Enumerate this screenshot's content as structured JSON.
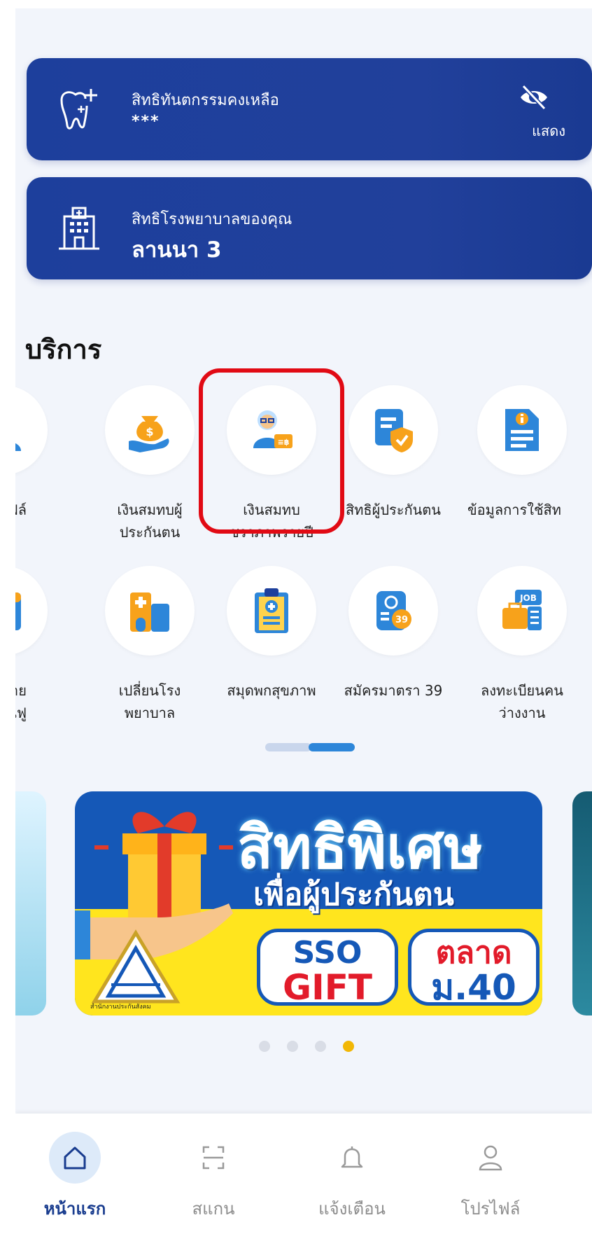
{
  "cards": {
    "dental": {
      "label": "สิทธิทันตกรรมคงเหลือ",
      "value": "***",
      "toggle_label": "แสดง"
    },
    "hospital": {
      "label": "สิทธิโรงพยาบาลของคุณ",
      "value": "ลานนา 3"
    }
  },
  "services": {
    "title": "บริการ",
    "row1": [
      {
        "label": "ไฟล์",
        "icon": "profile-icon"
      },
      {
        "label": "เงินสมทบผู้\nประกันตน",
        "icon": "money-bag-icon"
      },
      {
        "label": "เงินสมทบ\nชราภาพรายปี",
        "icon": "elderly-pension-icon"
      },
      {
        "label": "สิทธิผู้ประกันตน",
        "icon": "document-shield-icon"
      },
      {
        "label": "ข้อมูลการใช้สิท",
        "icon": "info-document-icon"
      }
    ],
    "row2": [
      {
        "label": "ัดหมาย\nฟื้นฟู",
        "icon": "calendar-icon"
      },
      {
        "label": "เปลี่ยนโรง\nพยาบาล",
        "icon": "hospital-building-icon"
      },
      {
        "label": "สมุดพกสุขภาพ",
        "icon": "health-clipboard-icon"
      },
      {
        "label": "สมัครมาตรา 39",
        "icon": "section-39-icon"
      },
      {
        "label": "ลงทะเบียนคน\nว่างงาน",
        "icon": "job-briefcase-icon"
      }
    ]
  },
  "banner": {
    "headline": "สิทธิพิเศษ",
    "subheadline": "เพื่อผู้ประกันตน",
    "pill1_top": "SSO",
    "pill1_bottom": "GIFT",
    "pill2_top": "ตลาด",
    "pill2_bottom": "ม.40",
    "org": "สำนักงานประกันสังคม"
  },
  "carousel": {
    "total": 4,
    "active_index": 3
  },
  "tabbar": [
    {
      "label": "หน้าแรก",
      "icon": "home-icon",
      "active": true
    },
    {
      "label": "สแกน",
      "icon": "scan-icon",
      "active": false
    },
    {
      "label": "แจ้งเตือน",
      "icon": "bell-icon",
      "active": false
    },
    {
      "label": "โปรไฟล์",
      "icon": "user-icon",
      "active": false
    }
  ],
  "colors": {
    "primary": "#1d3f9c",
    "highlight": "#e10a14",
    "accent": "#f2b705"
  }
}
